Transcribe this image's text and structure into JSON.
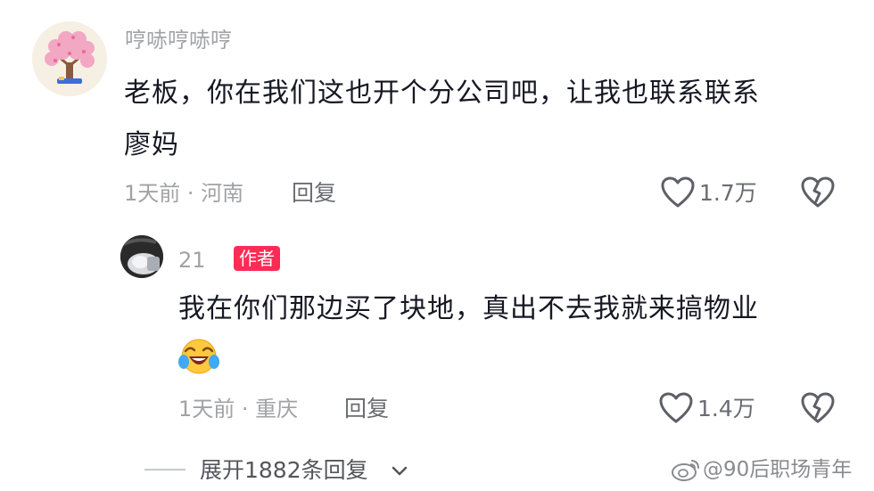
{
  "comment": {
    "username": "哼哧哼哧哼",
    "text_line1": "老板，你在我们这也开个分公司吧，让我也联系联系",
    "text_line2": "廖妈",
    "time_location": "1天前 · 河南",
    "reply_label": "回复",
    "like_count": "1.7万",
    "avatar_icon": "cherry-blossom-tree-avatar"
  },
  "reply": {
    "username": "21",
    "author_badge": "作者",
    "text": "我在你们那边买了块地，真出不去我就来搞物业",
    "emoji_icon": "crying-laughing-face-icon",
    "time_location": "1天前 · 重庆",
    "reply_label": "回复",
    "like_count": "1.4万"
  },
  "expand": {
    "label": "展开1882条回复"
  },
  "watermark": {
    "text": "@90后职场青年"
  },
  "colors": {
    "badge": "#fe2c55",
    "secondary_text": "#a1a2a6",
    "primary_text": "#161823"
  }
}
